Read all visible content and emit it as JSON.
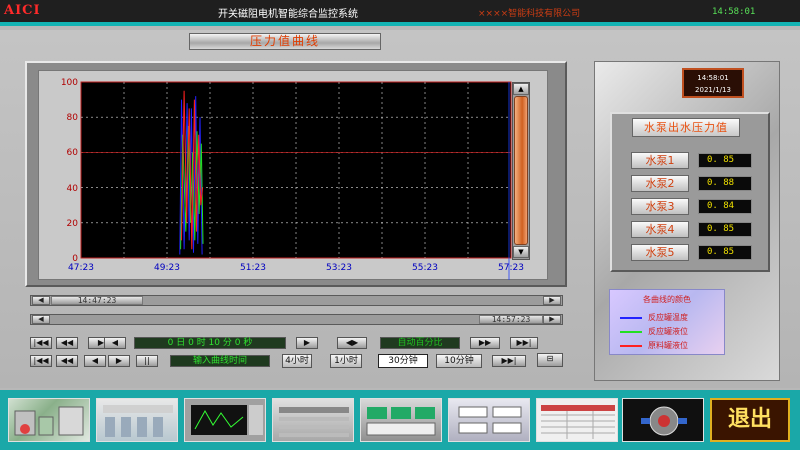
{
  "titlebar": {
    "logo": "AICI",
    "title": "开关磁阻电机智能综合监控系统",
    "company": "××××智能科技有限公司",
    "clock": "14:58:01"
  },
  "chart_title": "压力值曲线",
  "chart_data": {
    "type": "line",
    "title": "",
    "xlabel": "",
    "ylabel": "",
    "ylim": [
      0,
      100
    ],
    "xlim": [
      "47:23",
      "57:23"
    ],
    "y_ticks": [
      "100",
      "80",
      "60",
      "40",
      "20",
      "0"
    ],
    "x_ticks": [
      "47:23",
      "49:23",
      "51:23",
      "53:23",
      "55:23",
      "57:23"
    ],
    "grid": true,
    "series": [
      {
        "name": "反应罐温度",
        "color": "#2222ff",
        "x_min": [
          49.68,
          49.72,
          49.78,
          49.85,
          49.9,
          49.95,
          50.0,
          50.05,
          50.1,
          50.15,
          50.2
        ],
        "y": [
          2,
          90,
          5,
          88,
          10,
          85,
          3,
          92,
          8,
          80,
          2
        ]
      },
      {
        "name": "反应罐液位",
        "color": "#22e022",
        "x_min": [
          49.7,
          49.75,
          49.82,
          49.88,
          49.93,
          49.98,
          50.03,
          50.08,
          50.13,
          50.18,
          50.22
        ],
        "y": [
          5,
          70,
          15,
          75,
          20,
          60,
          10,
          72,
          25,
          65,
          8
        ]
      },
      {
        "name": "原料罐液位",
        "color": "#ff2020",
        "x_min": [
          49.72,
          49.78,
          49.84,
          49.9,
          49.96,
          50.02,
          50.07,
          50.12,
          50.17,
          50.21
        ],
        "y": [
          10,
          95,
          20,
          85,
          5,
          90,
          15,
          70,
          30,
          40
        ]
      }
    ]
  },
  "timeline": {
    "left_thumb": "14:47:23",
    "right_thumb": "14:57:23"
  },
  "toolbar": {
    "duration": "0 日 0 时 10 分 0 秒",
    "auto_scale": "自动百分比",
    "import_btn": "输入曲线时间",
    "range_4h": "4小时",
    "range_1h": "1小时",
    "range_30m": "30分钟",
    "range_10m": "10分钟"
  },
  "right_panel": {
    "date_time": "14:58:01",
    "date": "2021/1/13",
    "pressure_title": "水泵出水压力值",
    "pumps": [
      {
        "label": "水泵1",
        "value": "0. 85"
      },
      {
        "label": "水泵2",
        "value": "0. 88"
      },
      {
        "label": "水泵3",
        "value": "0. 84"
      },
      {
        "label": "水泵4",
        "value": "0. 85"
      },
      {
        "label": "水泵5",
        "value": "0. 85"
      }
    ]
  },
  "legend": {
    "title": "各曲线的颜色",
    "items": [
      {
        "label": "反应罐温度",
        "color": "#2222ff"
      },
      {
        "label": "反应罐液位",
        "color": "#22e022"
      },
      {
        "label": "原料罐液位",
        "color": "#ff2020"
      }
    ]
  },
  "thumbnails": {
    "exit_label": "退出"
  }
}
